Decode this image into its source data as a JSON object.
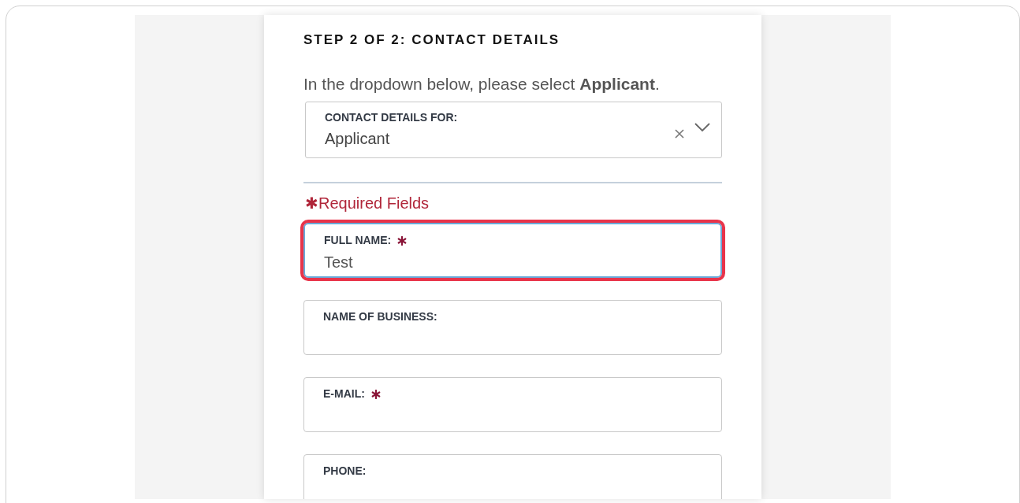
{
  "heading": "STEP 2 OF 2: CONTACT DETAILS",
  "instruction": "In the dropdown below, please select **Applicant**.",
  "dropdown": {
    "label": "CONTACT DETAILS FOR:",
    "value": "Applicant"
  },
  "required_note": "✱Required Fields",
  "fields": [
    {
      "label": "FULL NAME:",
      "required": true,
      "value": "Test",
      "highlighted": true
    },
    {
      "label": "NAME OF BUSINESS:",
      "required": false,
      "highlighted": false
    },
    {
      "label": "E-MAIL:",
      "required": true,
      "highlighted": false
    },
    {
      "label": "PHONE:",
      "required": false,
      "highlighted": false
    }
  ]
}
